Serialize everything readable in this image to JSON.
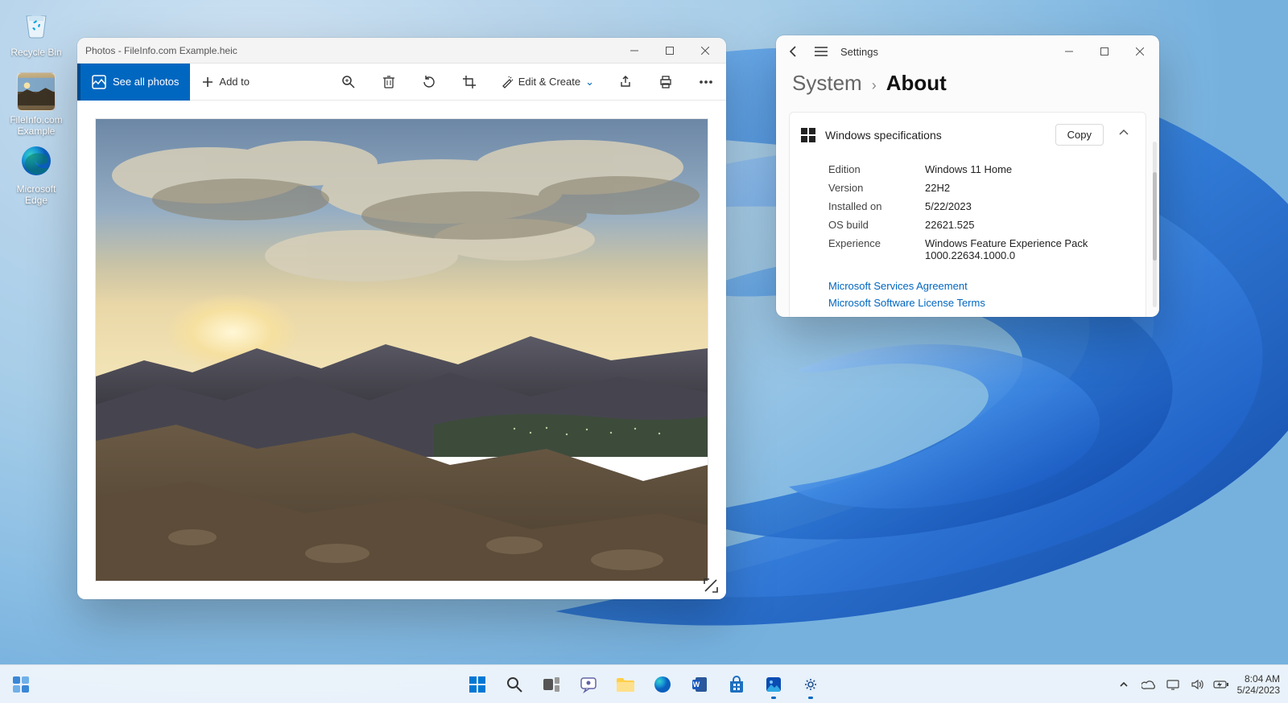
{
  "desktop": {
    "icons": {
      "recycle_bin": "Recycle Bin",
      "file_example": "FileInfo.com Example",
      "edge": "Microsoft Edge"
    }
  },
  "photos_window": {
    "title": "Photos - FileInfo.com Example.heic",
    "toolbar": {
      "see_all": "See all photos",
      "add_to": "Add to",
      "edit_create": "Edit & Create",
      "icons": {
        "zoom": "zoom-icon",
        "delete": "delete-icon",
        "rotate": "rotate-icon",
        "crop": "crop-icon",
        "share": "share-icon",
        "print": "print-icon",
        "more": "more-icon"
      }
    }
  },
  "settings_window": {
    "title": "Settings",
    "breadcrumb": {
      "level1": "System",
      "level2": "About"
    },
    "card": {
      "heading": "Windows specifications",
      "copy_label": "Copy",
      "rows": {
        "edition_k": "Edition",
        "edition_v": "Windows 11 Home",
        "version_k": "Version",
        "version_v": "22H2",
        "installed_k": "Installed on",
        "installed_v": "5/22/2023",
        "osbuild_k": "OS build",
        "osbuild_v": "22621.525",
        "experience_k": "Experience",
        "experience_v": "Windows Feature Experience Pack 1000.22634.1000.0"
      },
      "links": {
        "services": "Microsoft Services Agreement",
        "license": "Microsoft Software License Terms"
      }
    }
  },
  "taskbar": {
    "clock_time": "8:04 AM",
    "clock_date": "5/24/2023"
  }
}
